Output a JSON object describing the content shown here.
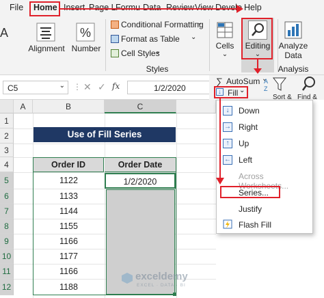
{
  "tabs": [
    "File",
    "Home",
    "Insert",
    "Page L",
    "Formu",
    "Data",
    "Review",
    "View",
    "Develo",
    "Help"
  ],
  "ribbon": {
    "alignment": "Alignment",
    "number": "Number",
    "cond_format": "Conditional Formatting",
    "format_table": "Format as Table",
    "cell_styles": "Cell Styles",
    "styles_group": "Styles",
    "cells": "Cells",
    "editing": "Editing",
    "analyze_l1": "Analyze",
    "analyze_l2": "Data",
    "analysis_group": "Analysis",
    "autosum": "AutoSum",
    "fill": "Fill",
    "sort": "Sort &",
    "find": "Find &"
  },
  "formula_bar": {
    "name_box": "C5",
    "fx": "fx",
    "value": "1/2/2020"
  },
  "columns": [
    "A",
    "B",
    "C"
  ],
  "rows": [
    "1",
    "2",
    "3",
    "4",
    "5",
    "6",
    "7",
    "8",
    "9",
    "10",
    "11",
    "12"
  ],
  "sheet": {
    "title": "Use of Fill Series",
    "header_id": "Order ID",
    "header_date": "Order Date",
    "order_ids": [
      "1122",
      "1133",
      "1144",
      "1155",
      "1166",
      "1177",
      "1166",
      "1188"
    ],
    "first_date": "1/2/2020"
  },
  "fill_menu": {
    "items": [
      "Down",
      "Right",
      "Up",
      "Left",
      "Across Worksheets...",
      "Series...",
      "Justify",
      "Flash Fill"
    ]
  },
  "watermark": "exceldemy",
  "watermark_sub": "EXCEL · DATA · BI",
  "colors": {
    "header_blue": "#1f3864",
    "table_border": "#2e7d4f",
    "red": "#e0202a",
    "gray_cell": "#cfcfcf"
  }
}
